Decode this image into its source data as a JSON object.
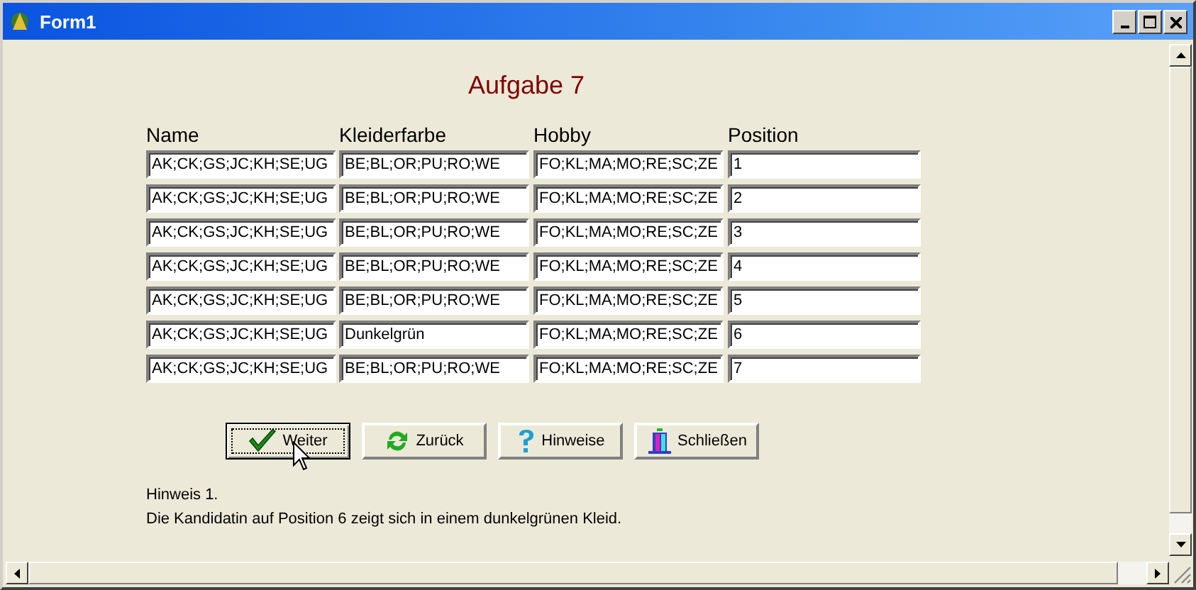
{
  "window": {
    "title": "Form1"
  },
  "heading": "Aufgabe 7",
  "columns": [
    "Name",
    "Kleiderfarbe",
    "Hobby",
    "Position"
  ],
  "rows": [
    [
      "AK;CK;GS;JC;KH;SE;UG",
      "BE;BL;OR;PU;RO;WE",
      "FO;KL;MA;MO;RE;SC;ZE",
      "1"
    ],
    [
      "AK;CK;GS;JC;KH;SE;UG",
      "BE;BL;OR;PU;RO;WE",
      "FO;KL;MA;MO;RE;SC;ZE",
      "2"
    ],
    [
      "AK;CK;GS;JC;KH;SE;UG",
      "BE;BL;OR;PU;RO;WE",
      "FO;KL;MA;MO;RE;SC;ZE",
      "3"
    ],
    [
      "AK;CK;GS;JC;KH;SE;UG",
      "BE;BL;OR;PU;RO;WE",
      "FO;KL;MA;MO;RE;SC;ZE",
      "4"
    ],
    [
      "AK;CK;GS;JC;KH;SE;UG",
      "BE;BL;OR;PU;RO;WE",
      "FO;KL;MA;MO;RE;SC;ZE",
      "5"
    ],
    [
      "AK;CK;GS;JC;KH;SE;UG",
      "Dunkelgrün",
      "FO;KL;MA;MO;RE;SC;ZE",
      "6"
    ],
    [
      "AK;CK;GS;JC;KH;SE;UG",
      "BE;BL;OR;PU;RO;WE",
      "FO;KL;MA;MO;RE;SC;ZE",
      "7"
    ]
  ],
  "buttons": [
    {
      "label": "Weiter",
      "kind": "check",
      "focused": true
    },
    {
      "label": "Zurück",
      "kind": "refresh",
      "focused": false
    },
    {
      "label": "Hinweise",
      "kind": "help",
      "focused": false
    },
    {
      "label": "Schließen",
      "kind": "exit",
      "focused": false
    }
  ],
  "hint": [
    "Hinweis 1.",
    "Die Kandidatin auf Position 6 zeigt sich in einem dunkelgrünen Kleid."
  ]
}
